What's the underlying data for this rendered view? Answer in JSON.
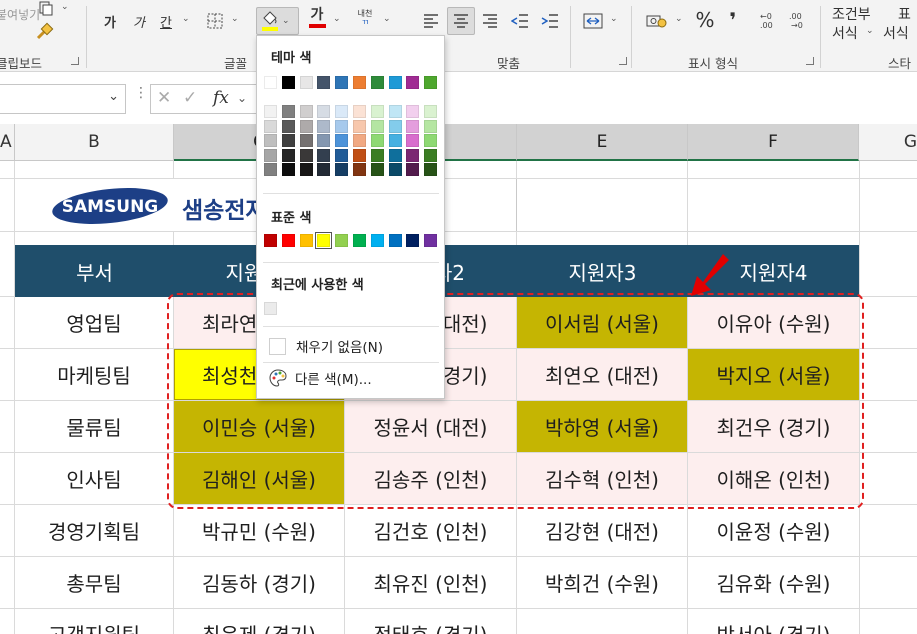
{
  "ribbon": {
    "paste_label": "붙여넣기",
    "clipboard_label": "클립보드",
    "font_group_label": "글꼴",
    "align_group_label": "맞춤",
    "number_group_label": "표시 형식",
    "style_group_label": "스타",
    "bold": "가",
    "italic": "가",
    "underline": "간",
    "font_color_glyph": "가",
    "phonetic_label": "내천",
    "comma_glyph": "❜",
    "percent_glyph": "%",
    "cond_format_line1": "조건부",
    "cond_format_line2": "서식",
    "table_format_line1": "표",
    "table_format_line2": "서식",
    "fill_color_hex": "#ffff00",
    "font_color_hex": "#e00000"
  },
  "formula_bar": {
    "fx_label": "fx"
  },
  "columns": [
    "A",
    "B",
    "C",
    "D",
    "E",
    "F",
    "G"
  ],
  "title": {
    "logo_text": "SAMSUNG",
    "company": "샘송전자"
  },
  "table": {
    "headers": [
      "부서",
      "지원자1",
      "지원자2",
      "지원자3",
      "지원자4"
    ],
    "rows": [
      [
        "영업팀",
        "최라연 (서울)",
        "김서진 (대전)",
        "이서림 (서울)",
        "이유아 (수원)"
      ],
      [
        "마케팅팀",
        "최성천 (서울)",
        "박민준 (경기)",
        "최연오 (대전)",
        "박지오 (서울)"
      ],
      [
        "물류팀",
        "이민승 (서울)",
        "정윤서 (대전)",
        "박하영 (서울)",
        "최건우 (경기)"
      ],
      [
        "인사팀",
        "김해인 (서울)",
        "김송주 (인천)",
        "김수혁 (인천)",
        "이해온 (인천)"
      ],
      [
        "경영기획팀",
        "박규민 (수원)",
        "김건호 (인천)",
        "김강현 (대전)",
        "이윤정 (수원)"
      ],
      [
        "총무팀",
        "김동하 (경기)",
        "최유진 (인천)",
        "박희건 (수원)",
        "김유화 (수원)"
      ],
      [
        "고객지원팀",
        "최은제 (경기)",
        "정태호 (경기)",
        "",
        "박서아 (경기)"
      ]
    ]
  },
  "colors": {
    "header_bg": "#1f4e6b",
    "highlight_olive": "#c5b502",
    "highlight_yellow": "#ffff00",
    "range_pink": "#fdeeee",
    "dashed_border": "#e02020",
    "arrow": "#e00000"
  },
  "dropdown": {
    "theme_colors_label": "테마 색",
    "standard_colors_label": "표준 색",
    "recent_colors_label": "최근에 사용한 색",
    "no_fill_label": "채우기 없음(N)",
    "more_colors_label": "다른 색(M)...",
    "theme_top": [
      "#ffffff",
      "#000000",
      "#e7e6e6",
      "#44546a",
      "#2e75b6",
      "#ed7d31",
      "#2e8b3a",
      "#1e9ad6",
      "#a02b93",
      "#4ea72e"
    ],
    "theme_shades": [
      [
        "#f2f2f2",
        "#808080",
        "#d0cece",
        "#d6dce4",
        "#dae9f8",
        "#fbe2d5",
        "#d9f2d0",
        "#c0e6f5",
        "#f2cfee",
        "#daf2d0"
      ],
      [
        "#d9d9d9",
        "#595959",
        "#aeaaaa",
        "#adb9ca",
        "#a6c9ec",
        "#f7c7ac",
        "#b4e5a2",
        "#83cceb",
        "#e49edd",
        "#b5e6a2"
      ],
      [
        "#bfbfbf",
        "#404040",
        "#757171",
        "#8497b0",
        "#4d93d9",
        "#f1a983",
        "#8ed973",
        "#45b0e1",
        "#d86dcd",
        "#8ed973"
      ],
      [
        "#a6a6a6",
        "#262626",
        "#3a3838",
        "#333f4f",
        "#215c98",
        "#c04f15",
        "#3b7d23",
        "#0f6f9c",
        "#7b2872",
        "#3b7d23"
      ],
      [
        "#808080",
        "#0d0d0d",
        "#171616",
        "#222a35",
        "#153d64",
        "#813511",
        "#275317",
        "#0a4a68",
        "#521b4c",
        "#275317"
      ]
    ],
    "standard": [
      "#c00000",
      "#ff0000",
      "#ffc000",
      "#ffff00",
      "#92d050",
      "#00b050",
      "#00b0f0",
      "#0070c0",
      "#002060",
      "#7030a0"
    ],
    "recent": [
      "#ebebeb"
    ]
  }
}
